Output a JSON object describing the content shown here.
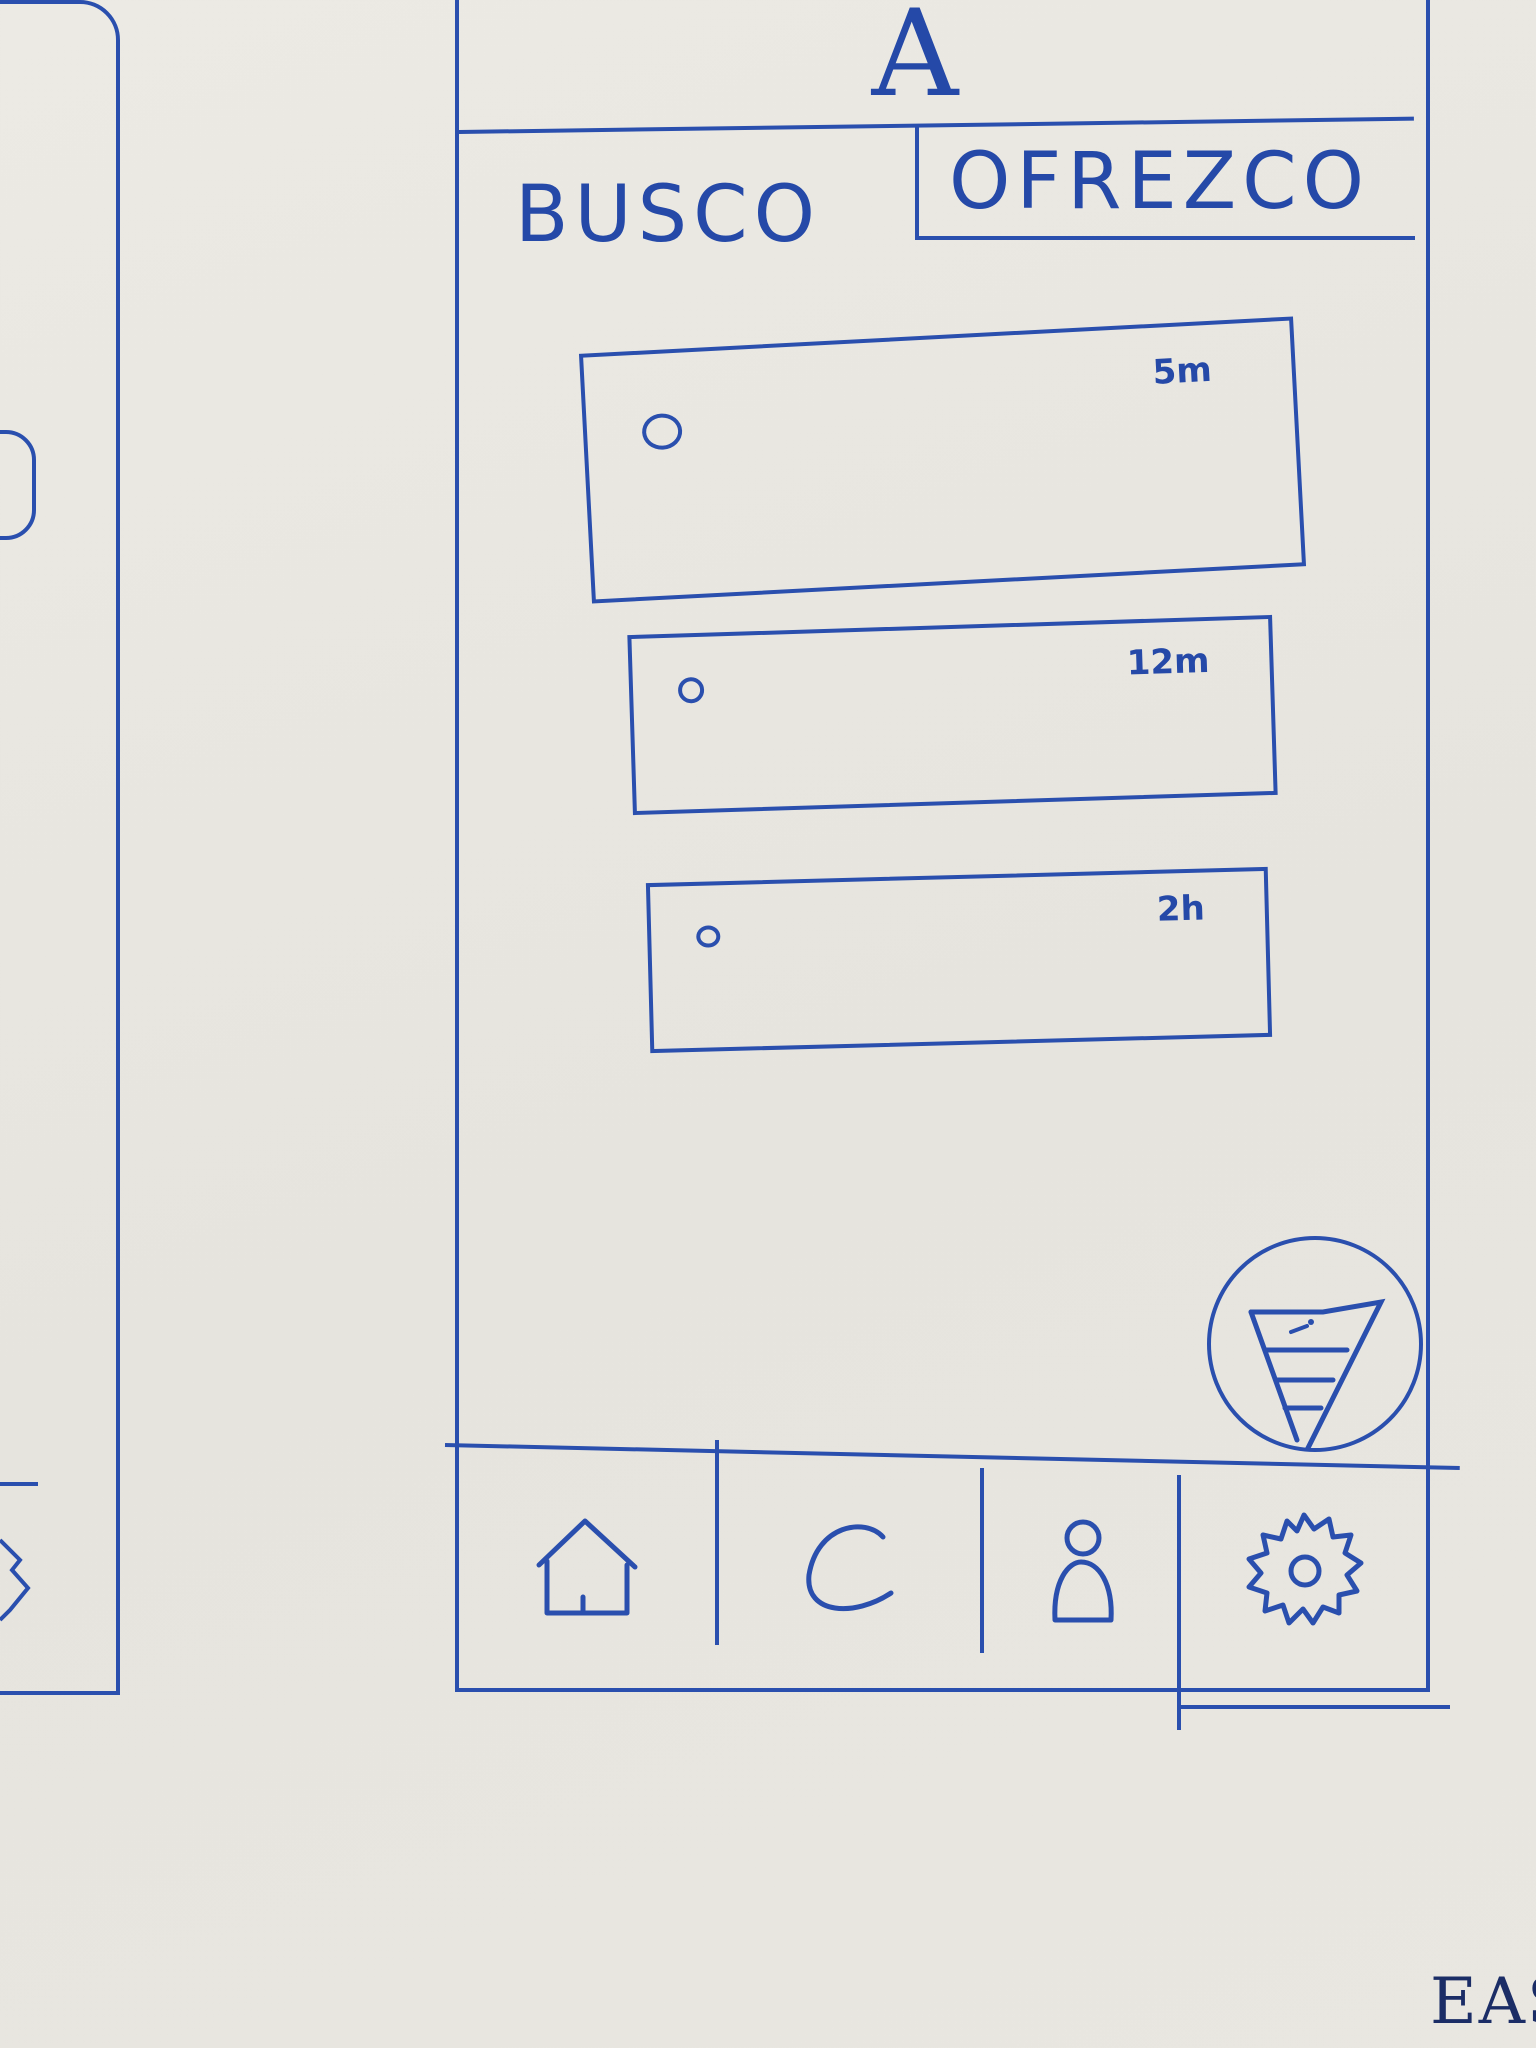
{
  "app": {
    "title": "A"
  },
  "tabs": [
    {
      "label": "BUSCO"
    },
    {
      "label": "OFREZCO"
    }
  ],
  "cards": [
    {
      "time": "5m"
    },
    {
      "time": "12m"
    },
    {
      "time": "2h"
    }
  ],
  "fab": {
    "icon": "funnel-filter-icon"
  },
  "bottom_nav": [
    {
      "icon": "home-icon"
    },
    {
      "icon": "chat-icon"
    },
    {
      "icon": "user-icon"
    },
    {
      "icon": "gear-icon"
    }
  ],
  "corner_text": "EAS",
  "colors": {
    "ink": "#2a4fae",
    "board": "#eceae4"
  }
}
